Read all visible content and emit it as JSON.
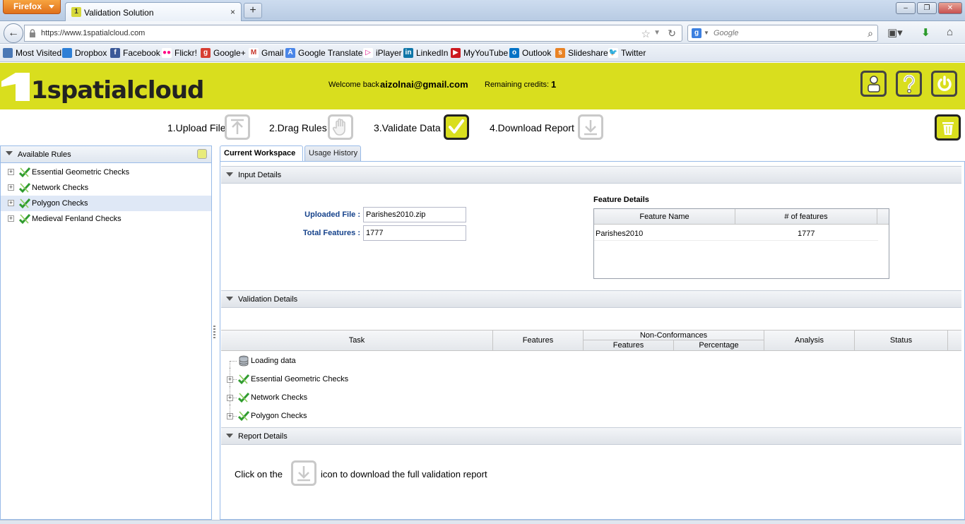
{
  "browser": {
    "menu_button": "Firefox",
    "tab_title": "Validation Solution",
    "tab_close": "×",
    "new_tab": "+",
    "url": "https://www.1spatialcloud.com",
    "search_placeholder": "Google",
    "window_controls": [
      "–",
      "❐",
      "✕"
    ],
    "bookmarks": [
      {
        "label": "Most Visited",
        "icon": "bookmarks-icon",
        "color": "#4a78b5"
      },
      {
        "label": "Dropbox",
        "icon": "dropbox-icon",
        "color": "#2d7fd6"
      },
      {
        "label": "Facebook",
        "icon": "facebook-icon",
        "color": "#3b5998"
      },
      {
        "label": "Flickr!",
        "icon": "flickr-icon",
        "color": "#ff0084"
      },
      {
        "label": "Google+",
        "icon": "googleplus-icon",
        "color": "#d73d32"
      },
      {
        "label": "Gmail",
        "icon": "gmail-icon",
        "color": "#c7362b"
      },
      {
        "label": "Google Translate",
        "icon": "translate-icon",
        "color": "#4a86e8"
      },
      {
        "label": "iPlayer",
        "icon": "iplayer-icon",
        "color": "#e0128c"
      },
      {
        "label": "LinkedIn",
        "icon": "linkedin-icon",
        "color": "#0e76a8"
      },
      {
        "label": "MyYouTube",
        "icon": "youtube-icon",
        "color": "#cc181e"
      },
      {
        "label": "Outlook",
        "icon": "outlook-icon",
        "color": "#0072c6"
      },
      {
        "label": "Slideshare",
        "icon": "slideshare-icon",
        "color": "#e98325"
      },
      {
        "label": "Twitter",
        "icon": "twitter-icon",
        "color": "#1da1f2"
      }
    ]
  },
  "header": {
    "logo_text": "1spatialcloud",
    "welcome_label": "Welcome back",
    "user_email": "aizolnai@gmail.com",
    "credits_label": "Remaining credits:",
    "credits_value": "1",
    "accent_color": "#d9de1e"
  },
  "steps": [
    {
      "label": "1.Upload File",
      "icon": "upload-arrow-icon"
    },
    {
      "label": "2.Drag Rules",
      "icon": "hand-icon"
    },
    {
      "label": "3.Validate Data",
      "icon": "checkmark-icon"
    },
    {
      "label": "4.Download Report",
      "icon": "download-arrow-icon"
    }
  ],
  "rules_panel": {
    "title": "Available Rules",
    "items": [
      {
        "label": "Essential Geometric Checks"
      },
      {
        "label": "Network Checks"
      },
      {
        "label": "Polygon Checks"
      },
      {
        "label": "Medieval Fenland Checks"
      }
    ]
  },
  "tabs": [
    {
      "label": "Current Workspace"
    },
    {
      "label": "Usage History"
    }
  ],
  "input_details": {
    "title": "Input Details",
    "uploaded_file_label": "Uploaded File :",
    "uploaded_file_value": "Parishes2010.zip",
    "total_features_label": "Total Features :",
    "total_features_value": "1777",
    "feature_details": {
      "title": "Feature Details",
      "columns": [
        "Feature Name",
        "# of features"
      ],
      "rows": [
        [
          "Parishes2010",
          "1777"
        ]
      ]
    }
  },
  "validation_details": {
    "title": "Validation Details",
    "columns": {
      "task": "Task",
      "features": "Features",
      "non_conformances": "Non-Conformances",
      "nc_features": "Features",
      "nc_percentage": "Percentage",
      "analysis": "Analysis",
      "status": "Status"
    },
    "tree": [
      {
        "label": "Loading data"
      },
      {
        "label": "Essential Geometric Checks"
      },
      {
        "label": "Network Checks"
      },
      {
        "label": "Polygon Checks"
      }
    ]
  },
  "report_details": {
    "title": "Report Details",
    "text_before": "Click on the",
    "text_after": "icon to download the full validation report"
  }
}
